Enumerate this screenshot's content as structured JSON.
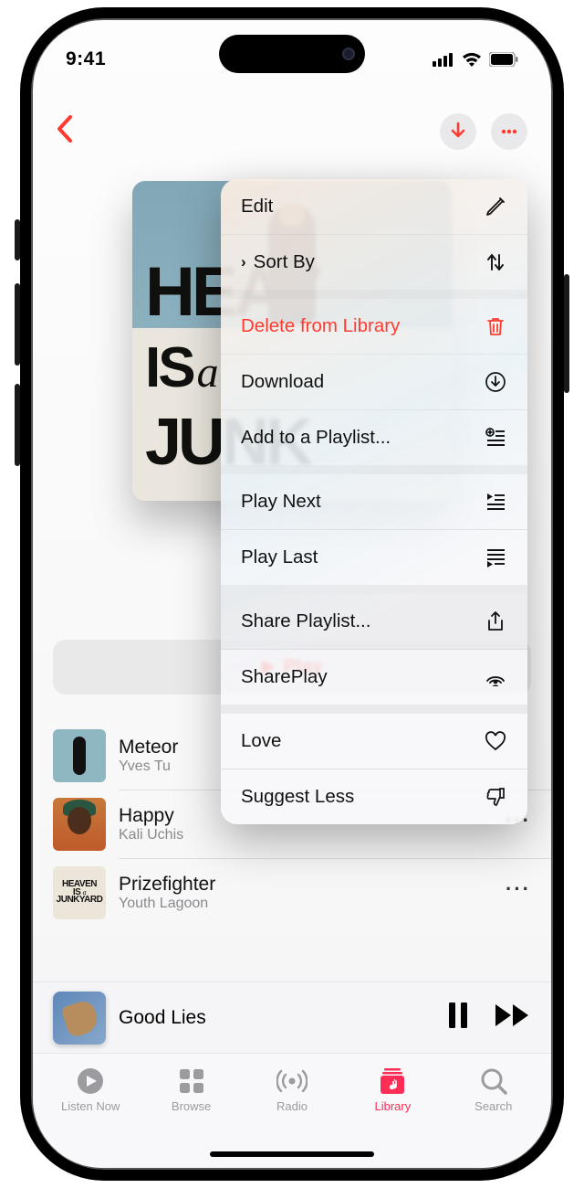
{
  "status": {
    "time": "9:41"
  },
  "nav": {
    "download_icon": "download-icon",
    "more_icon": "ellipsis-icon"
  },
  "art": {
    "line1": "HEAV",
    "line2a": "IS",
    "line2b": "a",
    "line3": "JUNK"
  },
  "play_button": {
    "label": "Play"
  },
  "tracks": [
    {
      "title": "Meteor",
      "artist": "Yves Tu"
    },
    {
      "title": "Happy",
      "artist": "Kali Uchis"
    },
    {
      "title": "Prizefighter",
      "artist": "Youth Lagoon"
    }
  ],
  "now_playing": {
    "title": "Good Lies"
  },
  "tabs": {
    "listen": "Listen Now",
    "browse": "Browse",
    "radio": "Radio",
    "library": "Library",
    "search": "Search"
  },
  "menu": {
    "edit": "Edit",
    "sort": "Sort By",
    "delete": "Delete from Library",
    "download": "Download",
    "add_playlist": "Add to a Playlist...",
    "play_next": "Play Next",
    "play_last": "Play Last",
    "share_playlist": "Share Playlist...",
    "shareplay": "SharePlay",
    "love": "Love",
    "suggest_less": "Suggest Less"
  },
  "thumb3": {
    "l1": "HEAVEN",
    "l2a": "IS",
    "l2b": "a",
    "l3": "JUNKYARD"
  }
}
